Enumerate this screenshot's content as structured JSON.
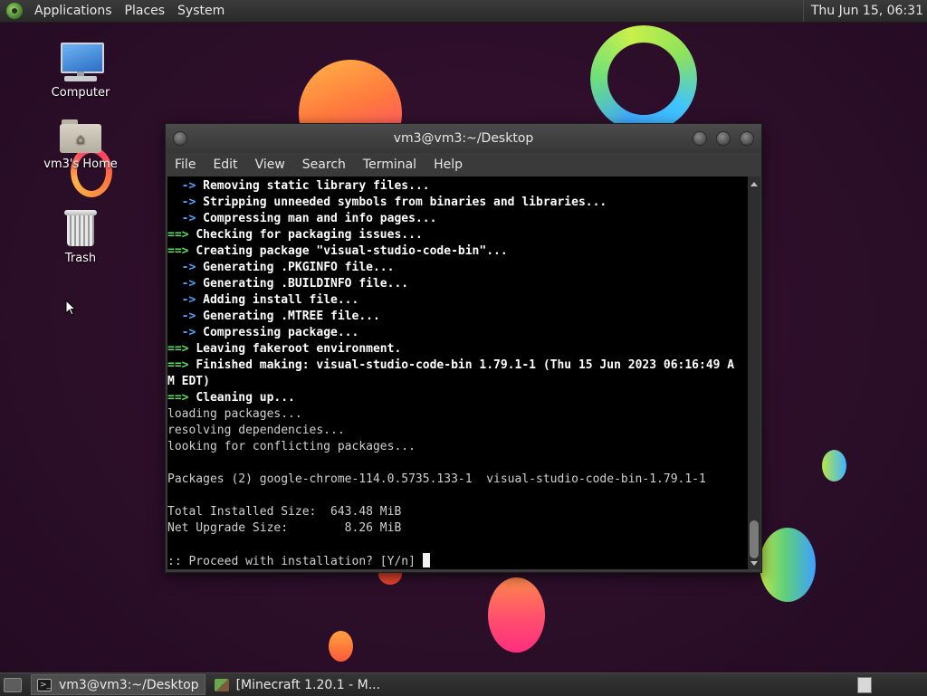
{
  "top_panel": {
    "menus": [
      "Applications",
      "Places",
      "System"
    ],
    "clock": "Thu Jun 15, 06:31"
  },
  "desktop": {
    "icons": [
      {
        "label": "Computer"
      },
      {
        "label": "vm3's Home"
      },
      {
        "label": "Trash"
      }
    ]
  },
  "terminal": {
    "title": "vm3@vm3:~/Desktop",
    "menus": [
      "File",
      "Edit",
      "View",
      "Search",
      "Terminal",
      "Help"
    ],
    "lines": [
      {
        "kind": "arrow",
        "text": "Removing static library files..."
      },
      {
        "kind": "arrow",
        "text": "Stripping unneeded symbols from binaries and libraries..."
      },
      {
        "kind": "arrow",
        "text": "Compressing man and info pages..."
      },
      {
        "kind": "stage",
        "text": "Checking for packaging issues..."
      },
      {
        "kind": "stage",
        "text": "Creating package \"visual-studio-code-bin\"..."
      },
      {
        "kind": "arrow",
        "text": "Generating .PKGINFO file..."
      },
      {
        "kind": "arrow",
        "text": "Generating .BUILDINFO file..."
      },
      {
        "kind": "arrow",
        "text": "Adding install file..."
      },
      {
        "kind": "arrow",
        "text": "Generating .MTREE file..."
      },
      {
        "kind": "arrow",
        "text": "Compressing package..."
      },
      {
        "kind": "stage",
        "text": "Leaving fakeroot environment."
      },
      {
        "kind": "stage",
        "text": "Finished making: visual-studio-code-bin 1.79.1-1 (Thu 15 Jun 2023 06:16:49 A"
      },
      {
        "kind": "bold",
        "text": "M EDT)"
      },
      {
        "kind": "stage",
        "text": "Cleaning up..."
      },
      {
        "kind": "plain",
        "text": "loading packages..."
      },
      {
        "kind": "plain",
        "text": "resolving dependencies..."
      },
      {
        "kind": "plain",
        "text": "looking for conflicting packages..."
      },
      {
        "kind": "plain",
        "text": ""
      },
      {
        "kind": "plain",
        "text": "Packages (2) google-chrome-114.0.5735.133-1  visual-studio-code-bin-1.79.1-1"
      },
      {
        "kind": "plain",
        "text": ""
      },
      {
        "kind": "plain",
        "text": "Total Installed Size:  643.48 MiB"
      },
      {
        "kind": "plain",
        "text": "Net Upgrade Size:        8.26 MiB"
      },
      {
        "kind": "plain",
        "text": ""
      },
      {
        "kind": "prompt",
        "text": ":: Proceed with installation? [Y/n] "
      }
    ],
    "arrow_prefix": "  -> ",
    "stage_prefix": "==> "
  },
  "taskbar": {
    "tasks": [
      {
        "label": "vm3@vm3:~/Desktop",
        "active": true
      },
      {
        "label": "[Minecraft 1.20.1 - M...",
        "active": false
      }
    ]
  },
  "colors": {
    "arrow": "#4da6ff",
    "stage": "#56e05b",
    "background": "#2c0e29"
  }
}
